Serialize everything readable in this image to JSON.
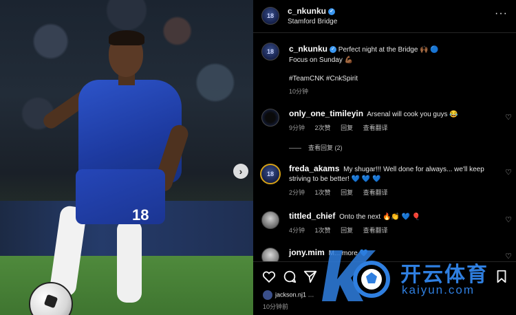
{
  "post": {
    "photo_alt_number": "18",
    "photo_board_text": "",
    "next_label": "›"
  },
  "header": {
    "username": "c_nkunku",
    "verified_mark": "✓",
    "location": "Stamford Bridge",
    "more_label": "···"
  },
  "caption": {
    "username": "c_nkunku",
    "verified_mark": "✓",
    "line1": "Perfect night at the Bridge 🙌🏾 🔵",
    "line2": "Focus on Sunday 💪🏾",
    "hashtags": "#TeamCNK #CnkSpirit",
    "time": "10分钟"
  },
  "avatars": {
    "badge_text": "18"
  },
  "comments": [
    {
      "username": "only_one_timileyin",
      "text": "Arsenal will cook you guys 😂",
      "time": "9分钟",
      "likes": "2次赞",
      "reply": "回复",
      "translate": "查看翻译",
      "view_replies": "查看回复 (2)"
    },
    {
      "username": "freda_akams",
      "text": "My shugar!!! Well done for always... we'll keep striving to be better! 💙 💙 💙",
      "time": "2分钟",
      "likes": "1次赞",
      "reply": "回复",
      "translate": "查看翻译"
    },
    {
      "username": "tittled_chief",
      "text": "Onto the next 🔥👏 💙 🎈",
      "time": "4分钟",
      "likes": "1次赞",
      "reply": "回复",
      "translate": "查看翻译"
    },
    {
      "username": "jony.mim",
      "text": "M... more 💙"
    }
  ],
  "footer": {
    "liked_by": "jackson.nj1 …",
    "post_time": "10分钟前"
  },
  "watermark": {
    "brand_cn": "开云体育",
    "url": "kaiyun.com"
  },
  "colors": {
    "verified": "#3a97f0",
    "watermark": "#2f7fe0"
  }
}
